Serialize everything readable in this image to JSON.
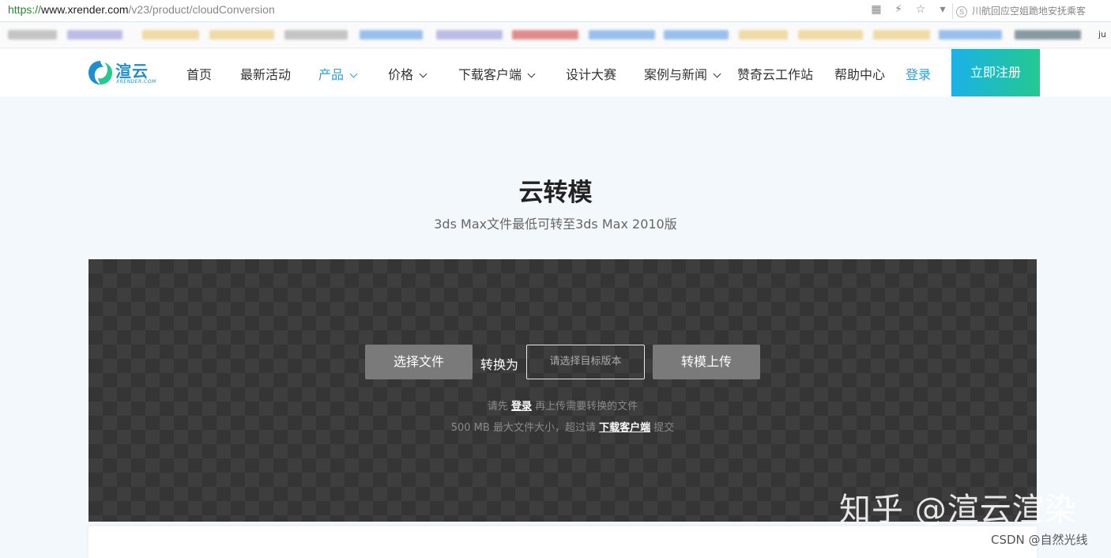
{
  "browser": {
    "url_scheme": "https://",
    "url_host": "www.xrender.com",
    "url_path": "/v23/product/cloudConversion",
    "hint_text": "川航回应空姐跪地安抚乘客",
    "bookmark_end": "ju"
  },
  "header": {
    "logo_text": "渲云",
    "logo_sub": "XRENDER.COM",
    "nav": [
      {
        "label": "首页"
      },
      {
        "label": "最新活动"
      },
      {
        "label": "产品"
      },
      {
        "label": "价格"
      },
      {
        "label": "下载客户端"
      },
      {
        "label": "设计大赛"
      },
      {
        "label": "案例与新闻"
      },
      {
        "label": "赞奇云工作站"
      },
      {
        "label": "帮助中心"
      }
    ],
    "login_label": "登录",
    "register_label": "立即注册"
  },
  "hero": {
    "title": "云转模",
    "subtitle": "3ds Max文件最低可转至3ds Max 2010版"
  },
  "upload": {
    "choose_file_label": "选择文件",
    "convert_to_label": "转换为",
    "version_placeholder": "请选择目标版本",
    "upload_label": "转模上传",
    "hint1_pre": "请先 ",
    "hint1_link": "登录",
    "hint1_post": " 再上传需要转换的文件",
    "hint2_pre": "500 MB 最大文件大小，超过请 ",
    "hint2_link": "下载客户端",
    "hint2_post": " 提交"
  },
  "watermark": {
    "zhihu": "知乎 @渲云渲染",
    "csdn": "CSDN @自然光线"
  },
  "colors": {
    "accent": "#2b9fdc",
    "register_gradient_start": "#1bb1e8",
    "register_gradient_end": "#23c98f",
    "panel_bg": "#3e3e3e",
    "button_grey": "#7a7a7a"
  }
}
